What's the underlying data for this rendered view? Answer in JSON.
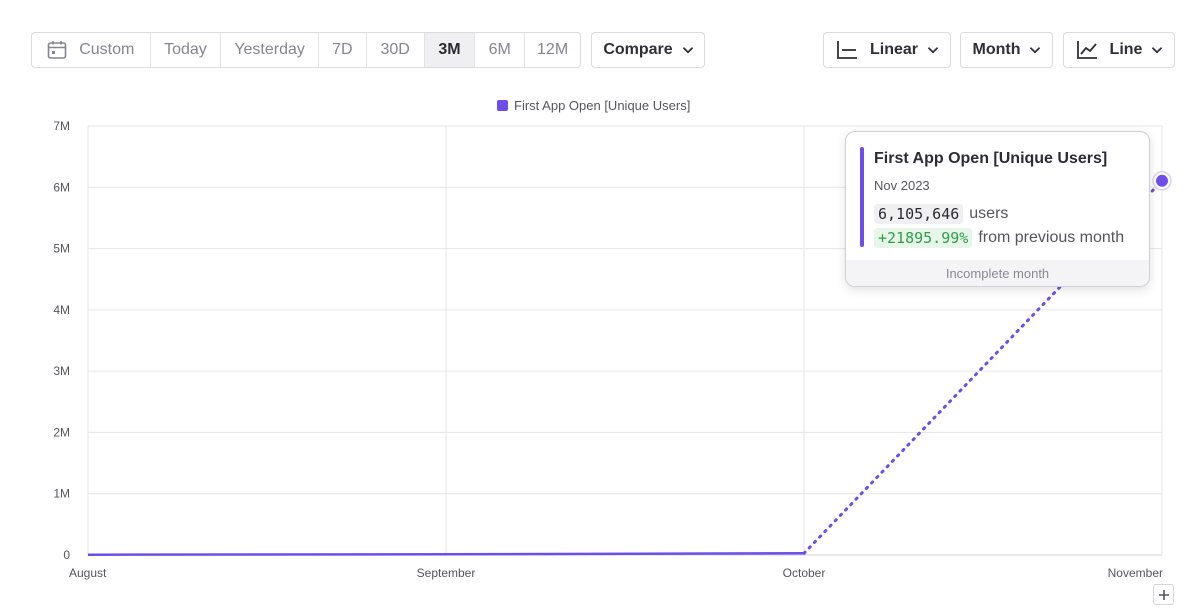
{
  "toolbar": {
    "ranges": [
      {
        "label": "Custom",
        "icon": "calendar-icon",
        "active": false
      },
      {
        "label": "Today",
        "active": false
      },
      {
        "label": "Yesterday",
        "active": false
      },
      {
        "label": "7D",
        "active": false
      },
      {
        "label": "30D",
        "active": false
      },
      {
        "label": "3M",
        "active": true
      },
      {
        "label": "6M",
        "active": false
      },
      {
        "label": "12M",
        "active": false
      }
    ],
    "compare_label": "Compare",
    "scale_label": "Linear",
    "scale_icon": "axis-icon",
    "interval_label": "Month",
    "chart_type_label": "Line",
    "chart_type_icon": "line-chart-icon"
  },
  "legend": {
    "label": "First App Open [Unique Users]",
    "color": "#6d4ee8"
  },
  "tooltip": {
    "title": "First App Open [Unique Users]",
    "date": "Nov 2023",
    "value": "6,105,646",
    "unit": "users",
    "change": "+21895.99%",
    "change_suffix": "from previous month",
    "footer": "Incomplete month"
  },
  "colors": {
    "accent": "#6d4ee8",
    "positive": "#2e9e48",
    "grid": "#e6e6ea"
  },
  "chart_data": {
    "type": "line",
    "title": "",
    "xlabel": "",
    "ylabel": "",
    "categories": [
      "August",
      "September",
      "October",
      "November"
    ],
    "series": [
      {
        "name": "First App Open [Unique Users]",
        "values": [
          5000,
          12000,
          27759,
          6105646
        ]
      }
    ],
    "ylim": [
      0,
      7000000
    ],
    "yticks": [
      0,
      1000000,
      2000000,
      3000000,
      4000000,
      5000000,
      6000000,
      7000000
    ],
    "ytick_labels": [
      "0",
      "1M",
      "2M",
      "3M",
      "4M",
      "5M",
      "6M",
      "7M"
    ],
    "incomplete_last_segment": true,
    "grid": true,
    "legend": "top-center"
  }
}
